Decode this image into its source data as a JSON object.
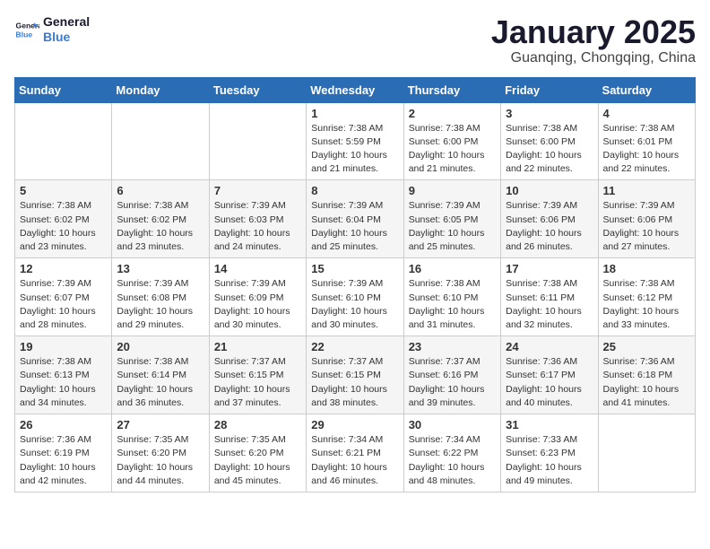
{
  "logo": {
    "line1": "General",
    "line2": "Blue"
  },
  "title": "January 2025",
  "location": "Guanqing, Chongqing, China",
  "weekdays": [
    "Sunday",
    "Monday",
    "Tuesday",
    "Wednesday",
    "Thursday",
    "Friday",
    "Saturday"
  ],
  "weeks": [
    [
      {
        "day": "",
        "info": ""
      },
      {
        "day": "",
        "info": ""
      },
      {
        "day": "",
        "info": ""
      },
      {
        "day": "1",
        "info": "Sunrise: 7:38 AM\nSunset: 5:59 PM\nDaylight: 10 hours\nand 21 minutes."
      },
      {
        "day": "2",
        "info": "Sunrise: 7:38 AM\nSunset: 6:00 PM\nDaylight: 10 hours\nand 21 minutes."
      },
      {
        "day": "3",
        "info": "Sunrise: 7:38 AM\nSunset: 6:00 PM\nDaylight: 10 hours\nand 22 minutes."
      },
      {
        "day": "4",
        "info": "Sunrise: 7:38 AM\nSunset: 6:01 PM\nDaylight: 10 hours\nand 22 minutes."
      }
    ],
    [
      {
        "day": "5",
        "info": "Sunrise: 7:38 AM\nSunset: 6:02 PM\nDaylight: 10 hours\nand 23 minutes."
      },
      {
        "day": "6",
        "info": "Sunrise: 7:38 AM\nSunset: 6:02 PM\nDaylight: 10 hours\nand 23 minutes."
      },
      {
        "day": "7",
        "info": "Sunrise: 7:39 AM\nSunset: 6:03 PM\nDaylight: 10 hours\nand 24 minutes."
      },
      {
        "day": "8",
        "info": "Sunrise: 7:39 AM\nSunset: 6:04 PM\nDaylight: 10 hours\nand 25 minutes."
      },
      {
        "day": "9",
        "info": "Sunrise: 7:39 AM\nSunset: 6:05 PM\nDaylight: 10 hours\nand 25 minutes."
      },
      {
        "day": "10",
        "info": "Sunrise: 7:39 AM\nSunset: 6:06 PM\nDaylight: 10 hours\nand 26 minutes."
      },
      {
        "day": "11",
        "info": "Sunrise: 7:39 AM\nSunset: 6:06 PM\nDaylight: 10 hours\nand 27 minutes."
      }
    ],
    [
      {
        "day": "12",
        "info": "Sunrise: 7:39 AM\nSunset: 6:07 PM\nDaylight: 10 hours\nand 28 minutes."
      },
      {
        "day": "13",
        "info": "Sunrise: 7:39 AM\nSunset: 6:08 PM\nDaylight: 10 hours\nand 29 minutes."
      },
      {
        "day": "14",
        "info": "Sunrise: 7:39 AM\nSunset: 6:09 PM\nDaylight: 10 hours\nand 30 minutes."
      },
      {
        "day": "15",
        "info": "Sunrise: 7:39 AM\nSunset: 6:10 PM\nDaylight: 10 hours\nand 30 minutes."
      },
      {
        "day": "16",
        "info": "Sunrise: 7:38 AM\nSunset: 6:10 PM\nDaylight: 10 hours\nand 31 minutes."
      },
      {
        "day": "17",
        "info": "Sunrise: 7:38 AM\nSunset: 6:11 PM\nDaylight: 10 hours\nand 32 minutes."
      },
      {
        "day": "18",
        "info": "Sunrise: 7:38 AM\nSunset: 6:12 PM\nDaylight: 10 hours\nand 33 minutes."
      }
    ],
    [
      {
        "day": "19",
        "info": "Sunrise: 7:38 AM\nSunset: 6:13 PM\nDaylight: 10 hours\nand 34 minutes."
      },
      {
        "day": "20",
        "info": "Sunrise: 7:38 AM\nSunset: 6:14 PM\nDaylight: 10 hours\nand 36 minutes."
      },
      {
        "day": "21",
        "info": "Sunrise: 7:37 AM\nSunset: 6:15 PM\nDaylight: 10 hours\nand 37 minutes."
      },
      {
        "day": "22",
        "info": "Sunrise: 7:37 AM\nSunset: 6:15 PM\nDaylight: 10 hours\nand 38 minutes."
      },
      {
        "day": "23",
        "info": "Sunrise: 7:37 AM\nSunset: 6:16 PM\nDaylight: 10 hours\nand 39 minutes."
      },
      {
        "day": "24",
        "info": "Sunrise: 7:36 AM\nSunset: 6:17 PM\nDaylight: 10 hours\nand 40 minutes."
      },
      {
        "day": "25",
        "info": "Sunrise: 7:36 AM\nSunset: 6:18 PM\nDaylight: 10 hours\nand 41 minutes."
      }
    ],
    [
      {
        "day": "26",
        "info": "Sunrise: 7:36 AM\nSunset: 6:19 PM\nDaylight: 10 hours\nand 42 minutes."
      },
      {
        "day": "27",
        "info": "Sunrise: 7:35 AM\nSunset: 6:20 PM\nDaylight: 10 hours\nand 44 minutes."
      },
      {
        "day": "28",
        "info": "Sunrise: 7:35 AM\nSunset: 6:20 PM\nDaylight: 10 hours\nand 45 minutes."
      },
      {
        "day": "29",
        "info": "Sunrise: 7:34 AM\nSunset: 6:21 PM\nDaylight: 10 hours\nand 46 minutes."
      },
      {
        "day": "30",
        "info": "Sunrise: 7:34 AM\nSunset: 6:22 PM\nDaylight: 10 hours\nand 48 minutes."
      },
      {
        "day": "31",
        "info": "Sunrise: 7:33 AM\nSunset: 6:23 PM\nDaylight: 10 hours\nand 49 minutes."
      },
      {
        "day": "",
        "info": ""
      }
    ]
  ]
}
